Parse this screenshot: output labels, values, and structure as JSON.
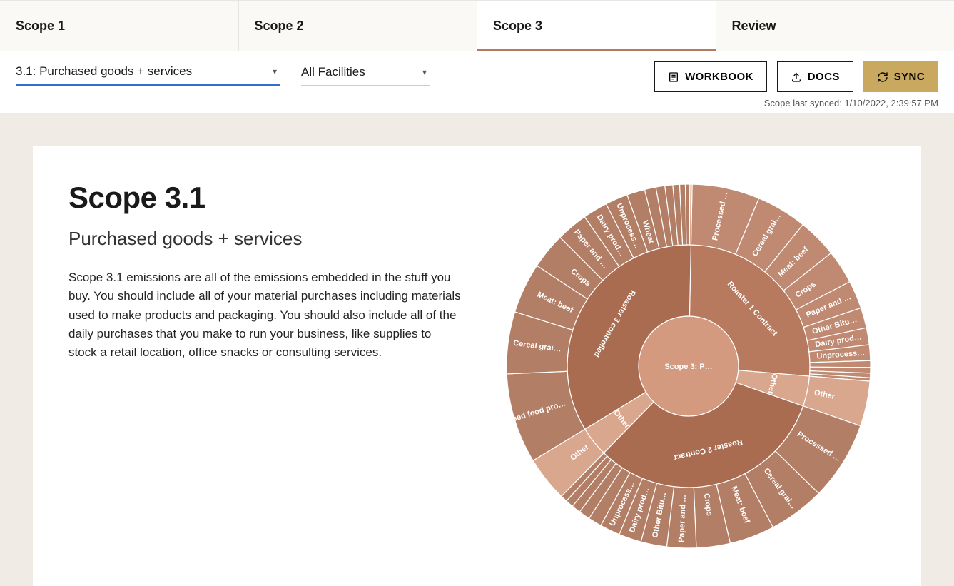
{
  "tabs": {
    "scope1": "Scope 1",
    "scope2": "Scope 2",
    "scope3": "Scope 3",
    "review": "Review"
  },
  "controls": {
    "category_select": "3.1: Purchased goods + services",
    "facility_select": "All Facilities",
    "workbook_btn": "WORKBOOK",
    "docs_btn": "DOCS",
    "sync_btn": "SYNC",
    "last_synced": "Scope last synced: 1/10/2022, 2:39:57 PM"
  },
  "panel": {
    "title": "Scope 3.1",
    "subtitle": "Purchased goods + services",
    "body": "Scope 3.1 emissions are all of the emissions embedded in the stuff you buy. You should include all of your material purchases including materials used to make products and packaging. You should also include all of the daily purchases that you make to run your business, like supplies to stock a retail location, office snacks or consulting services."
  },
  "chart_data": {
    "type": "sunburst",
    "title": "Scope 3: Purchased goods + services breakdown",
    "center_label": "Scope 3: P…",
    "levels": [
      "root",
      "facility",
      "material"
    ],
    "root": {
      "name": "Scope 3: P…",
      "value": 100
    },
    "series": [
      {
        "name": "Roaster 1 Contract",
        "value": 26,
        "color": "#b77a5f",
        "children": [
          {
            "name": "Processed …",
            "value": 6.0
          },
          {
            "name": "Cereal grai…",
            "value": 4.5
          },
          {
            "name": "Meat: beef",
            "value": 3.5
          },
          {
            "name": "Crops",
            "value": 3.0
          },
          {
            "name": "Paper and …",
            "value": 2.5
          },
          {
            "name": "Other Bitu…",
            "value": 1.8
          },
          {
            "name": "Dairy prod…",
            "value": 1.5
          },
          {
            "name": "Unprocess…",
            "value": 1.4
          },
          {
            "name": "",
            "value": 0.6
          },
          {
            "name": "",
            "value": 0.5
          },
          {
            "name": "",
            "value": 0.4
          },
          {
            "name": "",
            "value": 0.3
          }
        ]
      },
      {
        "name": "Other",
        "value": 4,
        "color": "#d9a68e",
        "children": [
          {
            "name": "Other",
            "value": 4.0
          }
        ]
      },
      {
        "name": "Roaster 2 Contract",
        "value": 32,
        "color": "#a96c51",
        "children": [
          {
            "name": "Processed …",
            "value": 7.0
          },
          {
            "name": "Cereal grai…",
            "value": 5.0
          },
          {
            "name": "Meat: beef",
            "value": 4.0
          },
          {
            "name": "Crops",
            "value": 3.0
          },
          {
            "name": "Paper and …",
            "value": 2.6
          },
          {
            "name": "Other Bitu…",
            "value": 2.3
          },
          {
            "name": "Dairy prod…",
            "value": 2.0
          },
          {
            "name": "Unprocess…",
            "value": 1.8
          },
          {
            "name": "",
            "value": 1.2
          },
          {
            "name": "",
            "value": 1.0
          },
          {
            "name": "",
            "value": 0.8
          },
          {
            "name": "",
            "value": 0.7
          },
          {
            "name": "",
            "value": 0.6
          }
        ]
      },
      {
        "name": "Other",
        "value": 4,
        "color": "#d9a68e",
        "children": [
          {
            "name": "Other",
            "value": 4.0
          }
        ]
      },
      {
        "name": "Roaster 3 controlled",
        "value": 34,
        "color": "#a96c51",
        "children": [
          {
            "name": "Processed food pro…",
            "value": 8.0
          },
          {
            "name": "Cereal grai…",
            "value": 5.5
          },
          {
            "name": "Meat: beef",
            "value": 4.5
          },
          {
            "name": "Crops",
            "value": 3.2
          },
          {
            "name": "Paper and …",
            "value": 2.8
          },
          {
            "name": "Dairy prod…",
            "value": 2.2
          },
          {
            "name": "Unprocess…",
            "value": 2.0
          },
          {
            "name": "Wheat",
            "value": 1.6
          },
          {
            "name": "",
            "value": 1.0
          },
          {
            "name": "",
            "value": 0.8
          },
          {
            "name": "",
            "value": 0.7
          },
          {
            "name": "",
            "value": 0.6
          },
          {
            "name": "",
            "value": 0.5
          },
          {
            "name": "",
            "value": 0.4
          },
          {
            "name": "Other",
            "value": 0.2,
            "faded": true
          }
        ]
      }
    ]
  }
}
